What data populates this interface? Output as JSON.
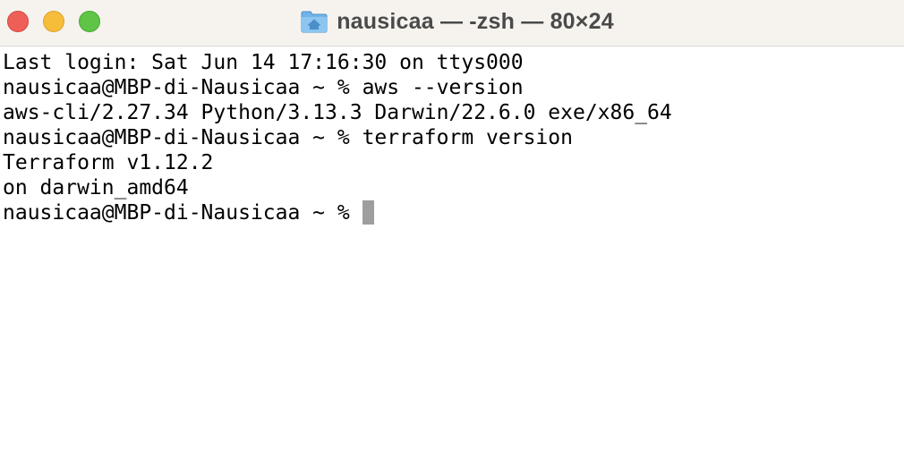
{
  "window": {
    "title": "nausicaa — -zsh — 80×24",
    "title_icon": "folder-home-icon",
    "controls": {
      "close": "close-icon",
      "minimize": "minimize-icon",
      "zoom": "zoom-icon"
    },
    "colors": {
      "close": "#ee5f57",
      "minimize": "#f6bd3b",
      "zoom": "#5ec546",
      "titlebar": "#f6f3ef",
      "cursor": "#9e9e9e"
    }
  },
  "terminal": {
    "lines": [
      "Last login: Sat Jun 14 17:16:30 on ttys000",
      "nausicaa@MBP-di-Nausicaa ~ % aws --version",
      "aws-cli/2.27.34 Python/3.13.3 Darwin/22.6.0 exe/x86_64",
      "nausicaa@MBP-di-Nausicaa ~ % terraform version",
      "Terraform v1.12.2",
      "on darwin_amd64"
    ],
    "prompt": "nausicaa@MBP-di-Nausicaa ~ %"
  }
}
